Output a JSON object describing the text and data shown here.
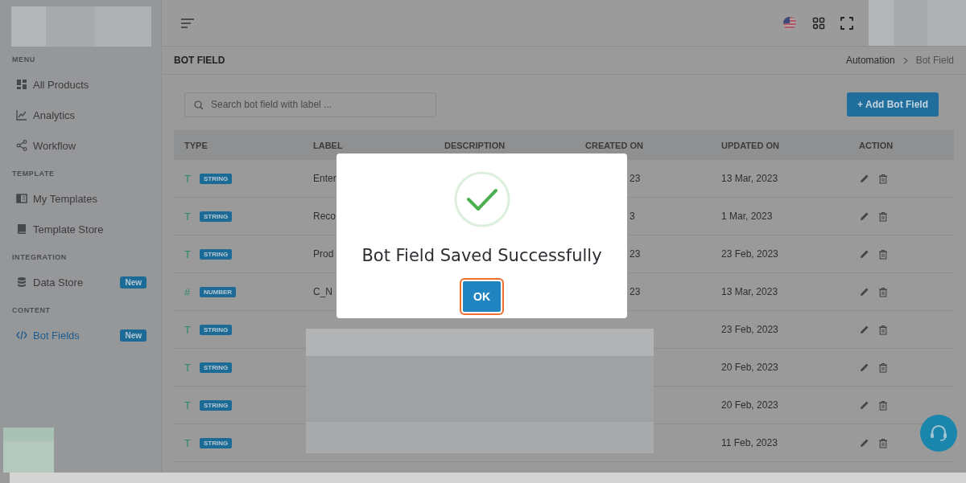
{
  "sidebar": {
    "sections": [
      {
        "heading": "MENU",
        "items": [
          {
            "label": "All Products",
            "selected": false
          },
          {
            "label": "Analytics",
            "selected": false
          },
          {
            "label": "Workflow",
            "selected": false
          }
        ]
      },
      {
        "heading": "TEMPLATE",
        "items": [
          {
            "label": "My Templates",
            "selected": false
          },
          {
            "label": "Template Store",
            "selected": false
          }
        ]
      },
      {
        "heading": "INTEGRATION",
        "items": [
          {
            "label": "Data Store",
            "selected": false,
            "badge": "New"
          }
        ]
      },
      {
        "heading": "CONTENT",
        "items": [
          {
            "label": "Bot Fields",
            "selected": true,
            "badge": "New"
          }
        ]
      }
    ]
  },
  "page": {
    "title": "BOT FIELD",
    "breadcrumb": [
      {
        "label": "Automation",
        "current": false
      },
      {
        "label": "Bot Field",
        "current": true
      }
    ]
  },
  "search": {
    "placeholder": "Search bot field with label ..."
  },
  "add_button": {
    "label": "+ Add Bot Field"
  },
  "table": {
    "columns": [
      "TYPE",
      "LABEL",
      "DESCRIPTION",
      "CREATED ON",
      "UPDATED ON",
      "ACTION"
    ],
    "rows": [
      {
        "type_icon": "T",
        "type": "STRING",
        "label": "Enter",
        "created_on": "23",
        "updated_on": "13 Mar, 2023"
      },
      {
        "type_icon": "T",
        "type": "STRING",
        "label": "Reco",
        "created_on": "3",
        "updated_on": "1 Mar, 2023"
      },
      {
        "type_icon": "T",
        "type": "STRING",
        "label": "Prod",
        "created_on": "23",
        "updated_on": "23 Feb, 2023"
      },
      {
        "type_icon": "#",
        "type": "NUMBER",
        "label": "C_N",
        "created_on": "23",
        "updated_on": "13 Mar, 2023"
      },
      {
        "type_icon": "T",
        "type": "STRING",
        "updated_on": "23 Feb, 2023"
      },
      {
        "type_icon": "T",
        "type": "STRING",
        "updated_on": "20 Feb, 2023"
      },
      {
        "type_icon": "T",
        "type": "STRING",
        "updated_on": "20 Feb, 2023"
      },
      {
        "type_icon": "T",
        "type": "STRING",
        "updated_on": "11 Feb, 2023"
      }
    ]
  },
  "dialog": {
    "message": "Bot Field Saved Successfully",
    "button": {
      "label": "OK",
      "focused": true
    }
  }
}
